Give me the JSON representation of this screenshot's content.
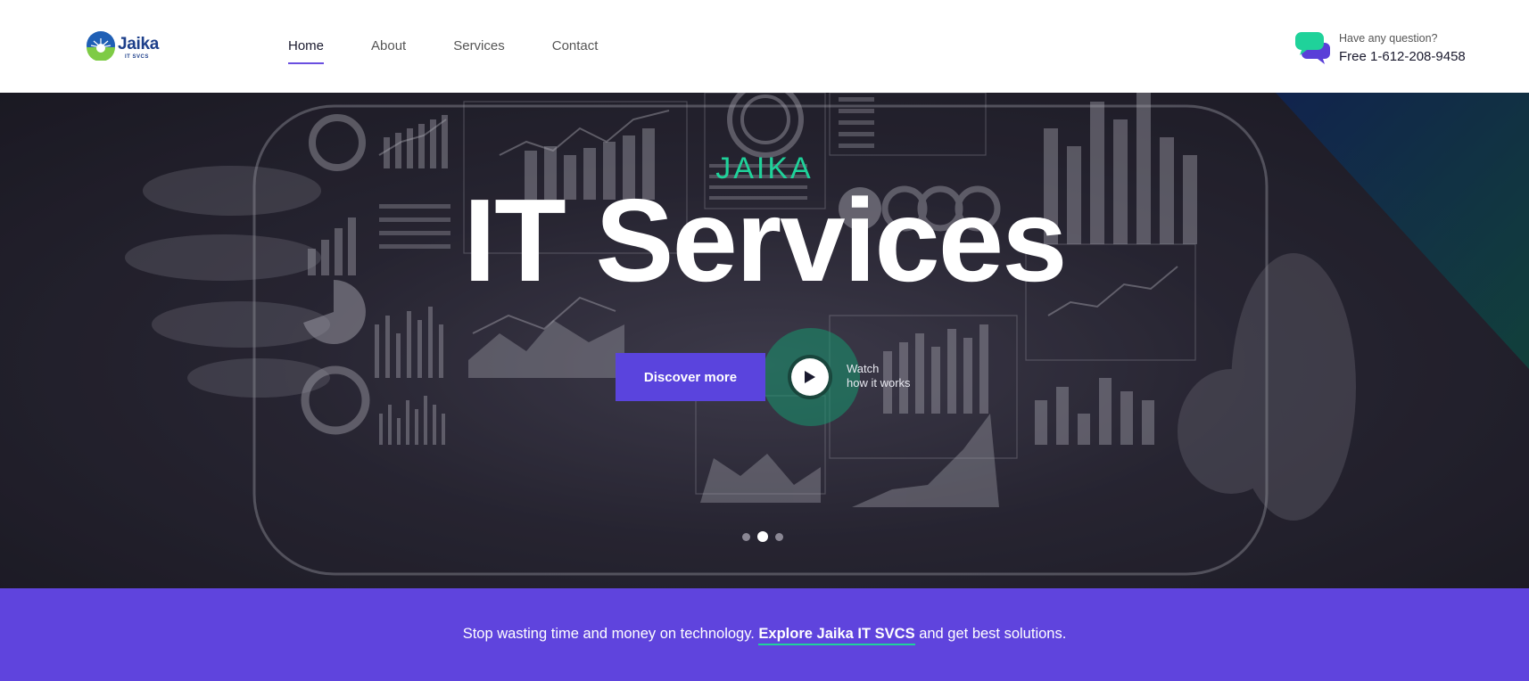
{
  "header": {
    "logo": {
      "title": "Jaika",
      "subtitle": "IT SVCS",
      "icon": "sunrise-logo-icon"
    },
    "nav": [
      {
        "label": "Home",
        "active": true
      },
      {
        "label": "About",
        "active": false
      },
      {
        "label": "Services",
        "active": false
      },
      {
        "label": "Contact",
        "active": false
      }
    ],
    "contact": {
      "question": "Have any question?",
      "phone": "Free 1-612-208-9458",
      "icon": "chat-bubbles-icon"
    }
  },
  "hero": {
    "brand": "JAIKA",
    "title": "IT Services",
    "cta_label": "Discover more",
    "watch_line1": "Watch",
    "watch_line2": "how it works",
    "play_icon": "play-icon",
    "slides_total": 3,
    "active_slide": 2
  },
  "banner": {
    "text_before": "Stop wasting time and money on technology.",
    "link_text": "Explore Jaika IT SVCS",
    "text_after": "and get best solutions."
  },
  "colors": {
    "accent": "#5f44dd",
    "brand_green": "#1fd29a",
    "logo_blue": "#1d3f8a"
  }
}
